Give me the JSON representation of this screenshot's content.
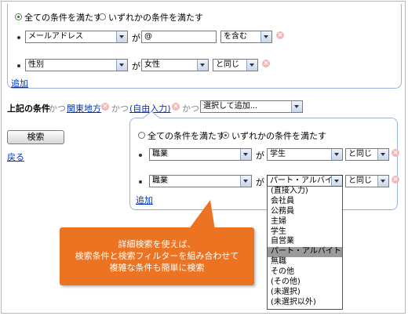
{
  "top": {
    "match_all": "全ての条件を満たす",
    "match_any": "いずれかの条件を満たす",
    "rows": [
      {
        "field": "メールアドレス",
        "ga": "が",
        "value": "@",
        "op": "を含む"
      },
      {
        "field": "性別",
        "ga": "が",
        "value": "女性",
        "op": "と同じ"
      }
    ],
    "add": "追加"
  },
  "chain": {
    "label": "上記の条件",
    "katsu": "かつ",
    "link1": "関東地方",
    "link2": "(自由入力)",
    "select": "選択して追加..."
  },
  "search_button": "検索",
  "back_link": "戻る",
  "sub": {
    "match_all": "全ての条件を満たす",
    "match_any": "いずれかの条件を満たす",
    "rows": [
      {
        "field": "職業",
        "ga": "が",
        "value": "学生",
        "op": "と同じ"
      },
      {
        "field": "職業",
        "ga": "が",
        "value": "パート・アルバイト",
        "op": "と同じ"
      }
    ],
    "add": "追加"
  },
  "dropdown_options": [
    "(直接入力)",
    "会社員",
    "公務員",
    "主婦",
    "学生",
    "自営業",
    "パート・アルバイト",
    "無職",
    "その他",
    "(その他)",
    "(未選択)",
    "(未選択以外)"
  ],
  "dropdown_selected_index": 6,
  "callout": {
    "line1": "詳細検索を使えば、",
    "line2": "検索条件と検索フィルターを組み合わせて",
    "line3": "複雑な条件も簡単に検索"
  },
  "colors": {
    "accent_orange": "#ec7322",
    "link": "#0033cc",
    "panel_border": "#9ab3de"
  }
}
